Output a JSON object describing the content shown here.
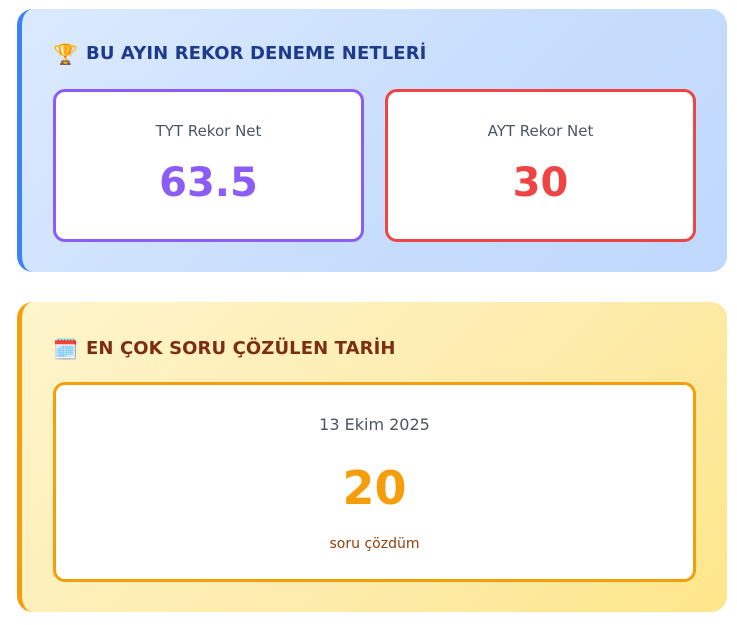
{
  "records": {
    "title": "BU AYIN REKOR DENEME NETLERİ",
    "icon": "trophy-icon",
    "accent": "#3b82f6",
    "tyt": {
      "label": "TYT Rekor Net",
      "value": "63.5",
      "color": "#8b5cf6"
    },
    "ayt": {
      "label": "AYT Rekor Net",
      "value": "30",
      "color": "#ef4444"
    }
  },
  "most_solved": {
    "title": "EN ÇOK SORU ÇÖZÜLEN TARİH",
    "icon": "calendar-icon",
    "accent": "#f59e0b",
    "date": "13 Ekim 2025",
    "count": "20",
    "caption": "soru çözdüm"
  }
}
